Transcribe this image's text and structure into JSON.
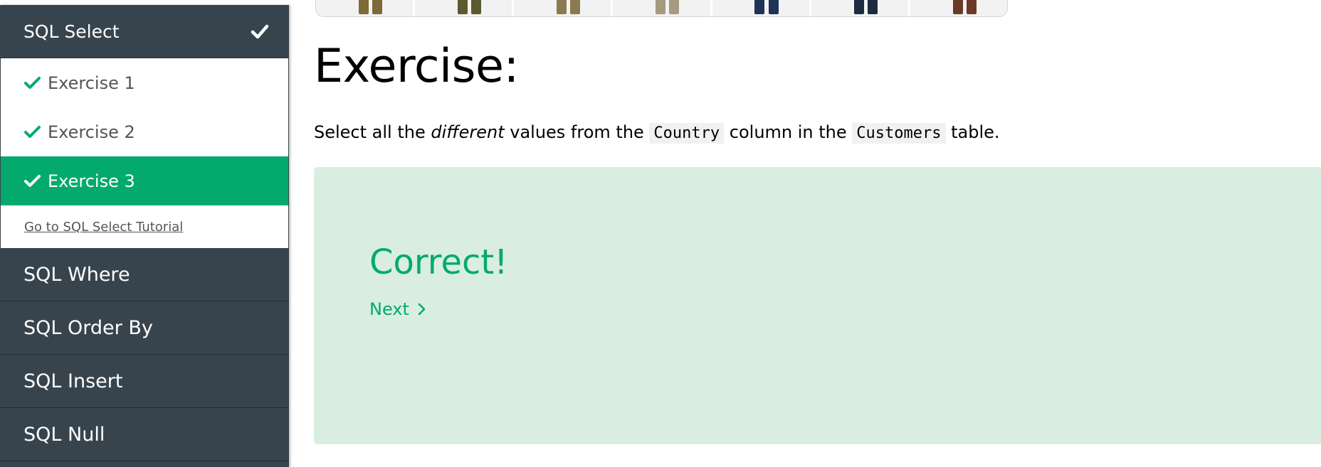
{
  "sidebar": {
    "header_label": "SQL Select",
    "exercises": [
      {
        "label": "Exercise 1",
        "completed": true,
        "active": false
      },
      {
        "label": "Exercise 2",
        "completed": true,
        "active": false
      },
      {
        "label": "Exercise 3",
        "completed": true,
        "active": true
      }
    ],
    "tutorial_link": "Go to SQL Select Tutorial",
    "sections": [
      "SQL Where",
      "SQL Order By",
      "SQL Insert",
      "SQL Null"
    ]
  },
  "ad_strip": {
    "thumb_colors": [
      "#7d6a37",
      "#5b5a2e",
      "#8a7a4f",
      "#a69a80",
      "#1f3357",
      "#1e2a3f",
      "#6b3a26"
    ]
  },
  "main": {
    "title": "Exercise:",
    "description": {
      "part1": "Select all the ",
      "emphasis": "different",
      "part2": " values from the ",
      "code1": "Country",
      "part3": " column in the ",
      "code2": "Customers",
      "part4": " table."
    },
    "result": {
      "status": "Correct!",
      "next_label": "Next"
    }
  },
  "colors": {
    "sidebar_bg": "#38444d",
    "accent_green": "#04aa6d",
    "result_bg": "#d9eee1"
  },
  "icons": {
    "header_check": "checkmark-icon",
    "exercise_check": "checkmark-icon",
    "next_arrow": "chevron-right-icon"
  }
}
